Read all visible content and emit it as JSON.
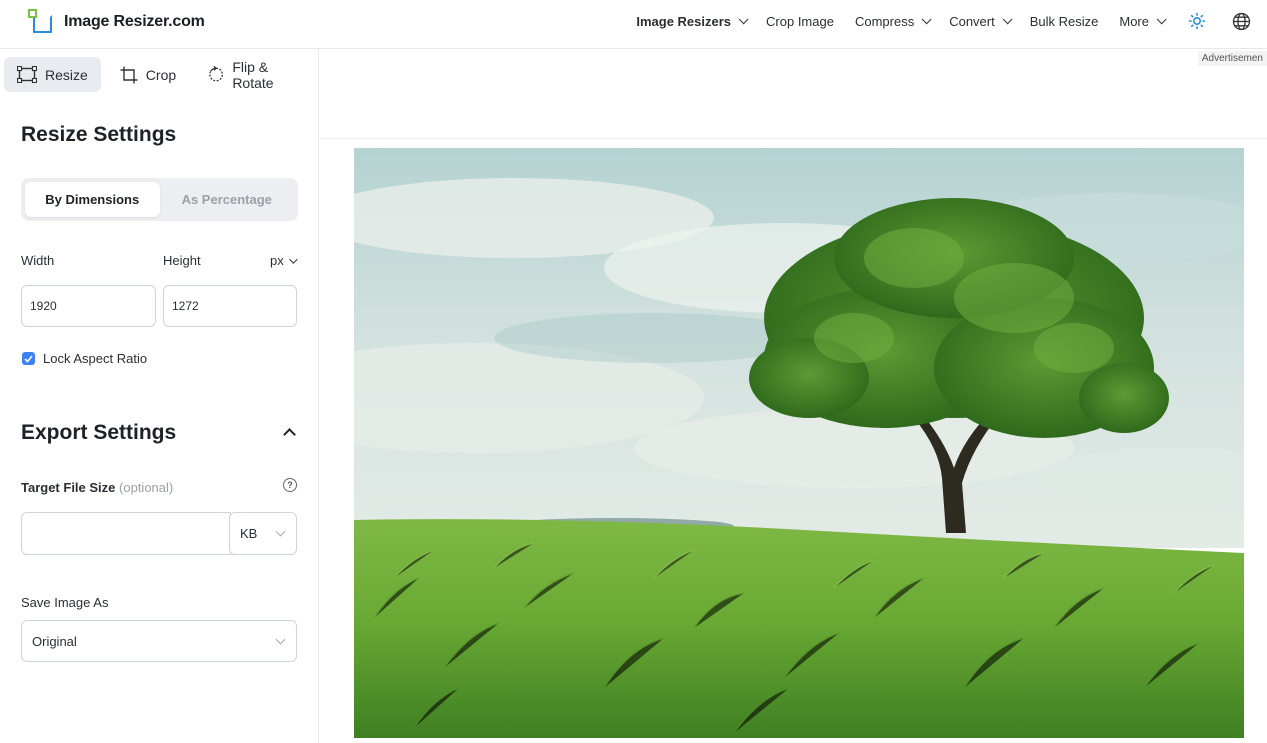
{
  "logo": {
    "text": "Image Resizer.com"
  },
  "nav": {
    "items": [
      {
        "label": "Image Resizers",
        "dropdown": true,
        "bold": true
      },
      {
        "label": "Crop Image",
        "dropdown": false,
        "bold": false
      },
      {
        "label": "Compress",
        "dropdown": true,
        "bold": false
      },
      {
        "label": "Convert",
        "dropdown": true,
        "bold": false
      },
      {
        "label": "Bulk Resize",
        "dropdown": false,
        "bold": false
      },
      {
        "label": "More",
        "dropdown": true,
        "bold": false
      }
    ],
    "icons": [
      "sun-icon",
      "globe-icon"
    ]
  },
  "ad_label": "Advertisemen",
  "tools": {
    "tabs": [
      {
        "label": "Resize",
        "icon": "resize-icon",
        "active": true
      },
      {
        "label": "Crop",
        "icon": "crop-icon",
        "active": false
      },
      {
        "label": "Flip & Rotate",
        "icon": "rotate-icon",
        "active": false
      }
    ]
  },
  "resize": {
    "title": "Resize Settings",
    "mode_tabs": [
      "By Dimensions",
      "As Percentage"
    ],
    "active_mode": "By Dimensions",
    "width_label": "Width",
    "height_label": "Height",
    "unit": "px",
    "width_value": "1920",
    "height_value": "1272",
    "lock_label": "Lock Aspect Ratio",
    "lock_checked": true
  },
  "export": {
    "title": "Export Settings",
    "target_label": "Target File Size",
    "target_optional": "(optional)",
    "target_value": "",
    "target_unit": "KB",
    "save_as_label": "Save Image As",
    "save_as_value": "Original"
  },
  "colors": {
    "accent": "#3b82f6",
    "logo_green": "#7bc043",
    "logo_blue": "#2a8dd8",
    "active_tab_bg": "#e8ecf1"
  }
}
